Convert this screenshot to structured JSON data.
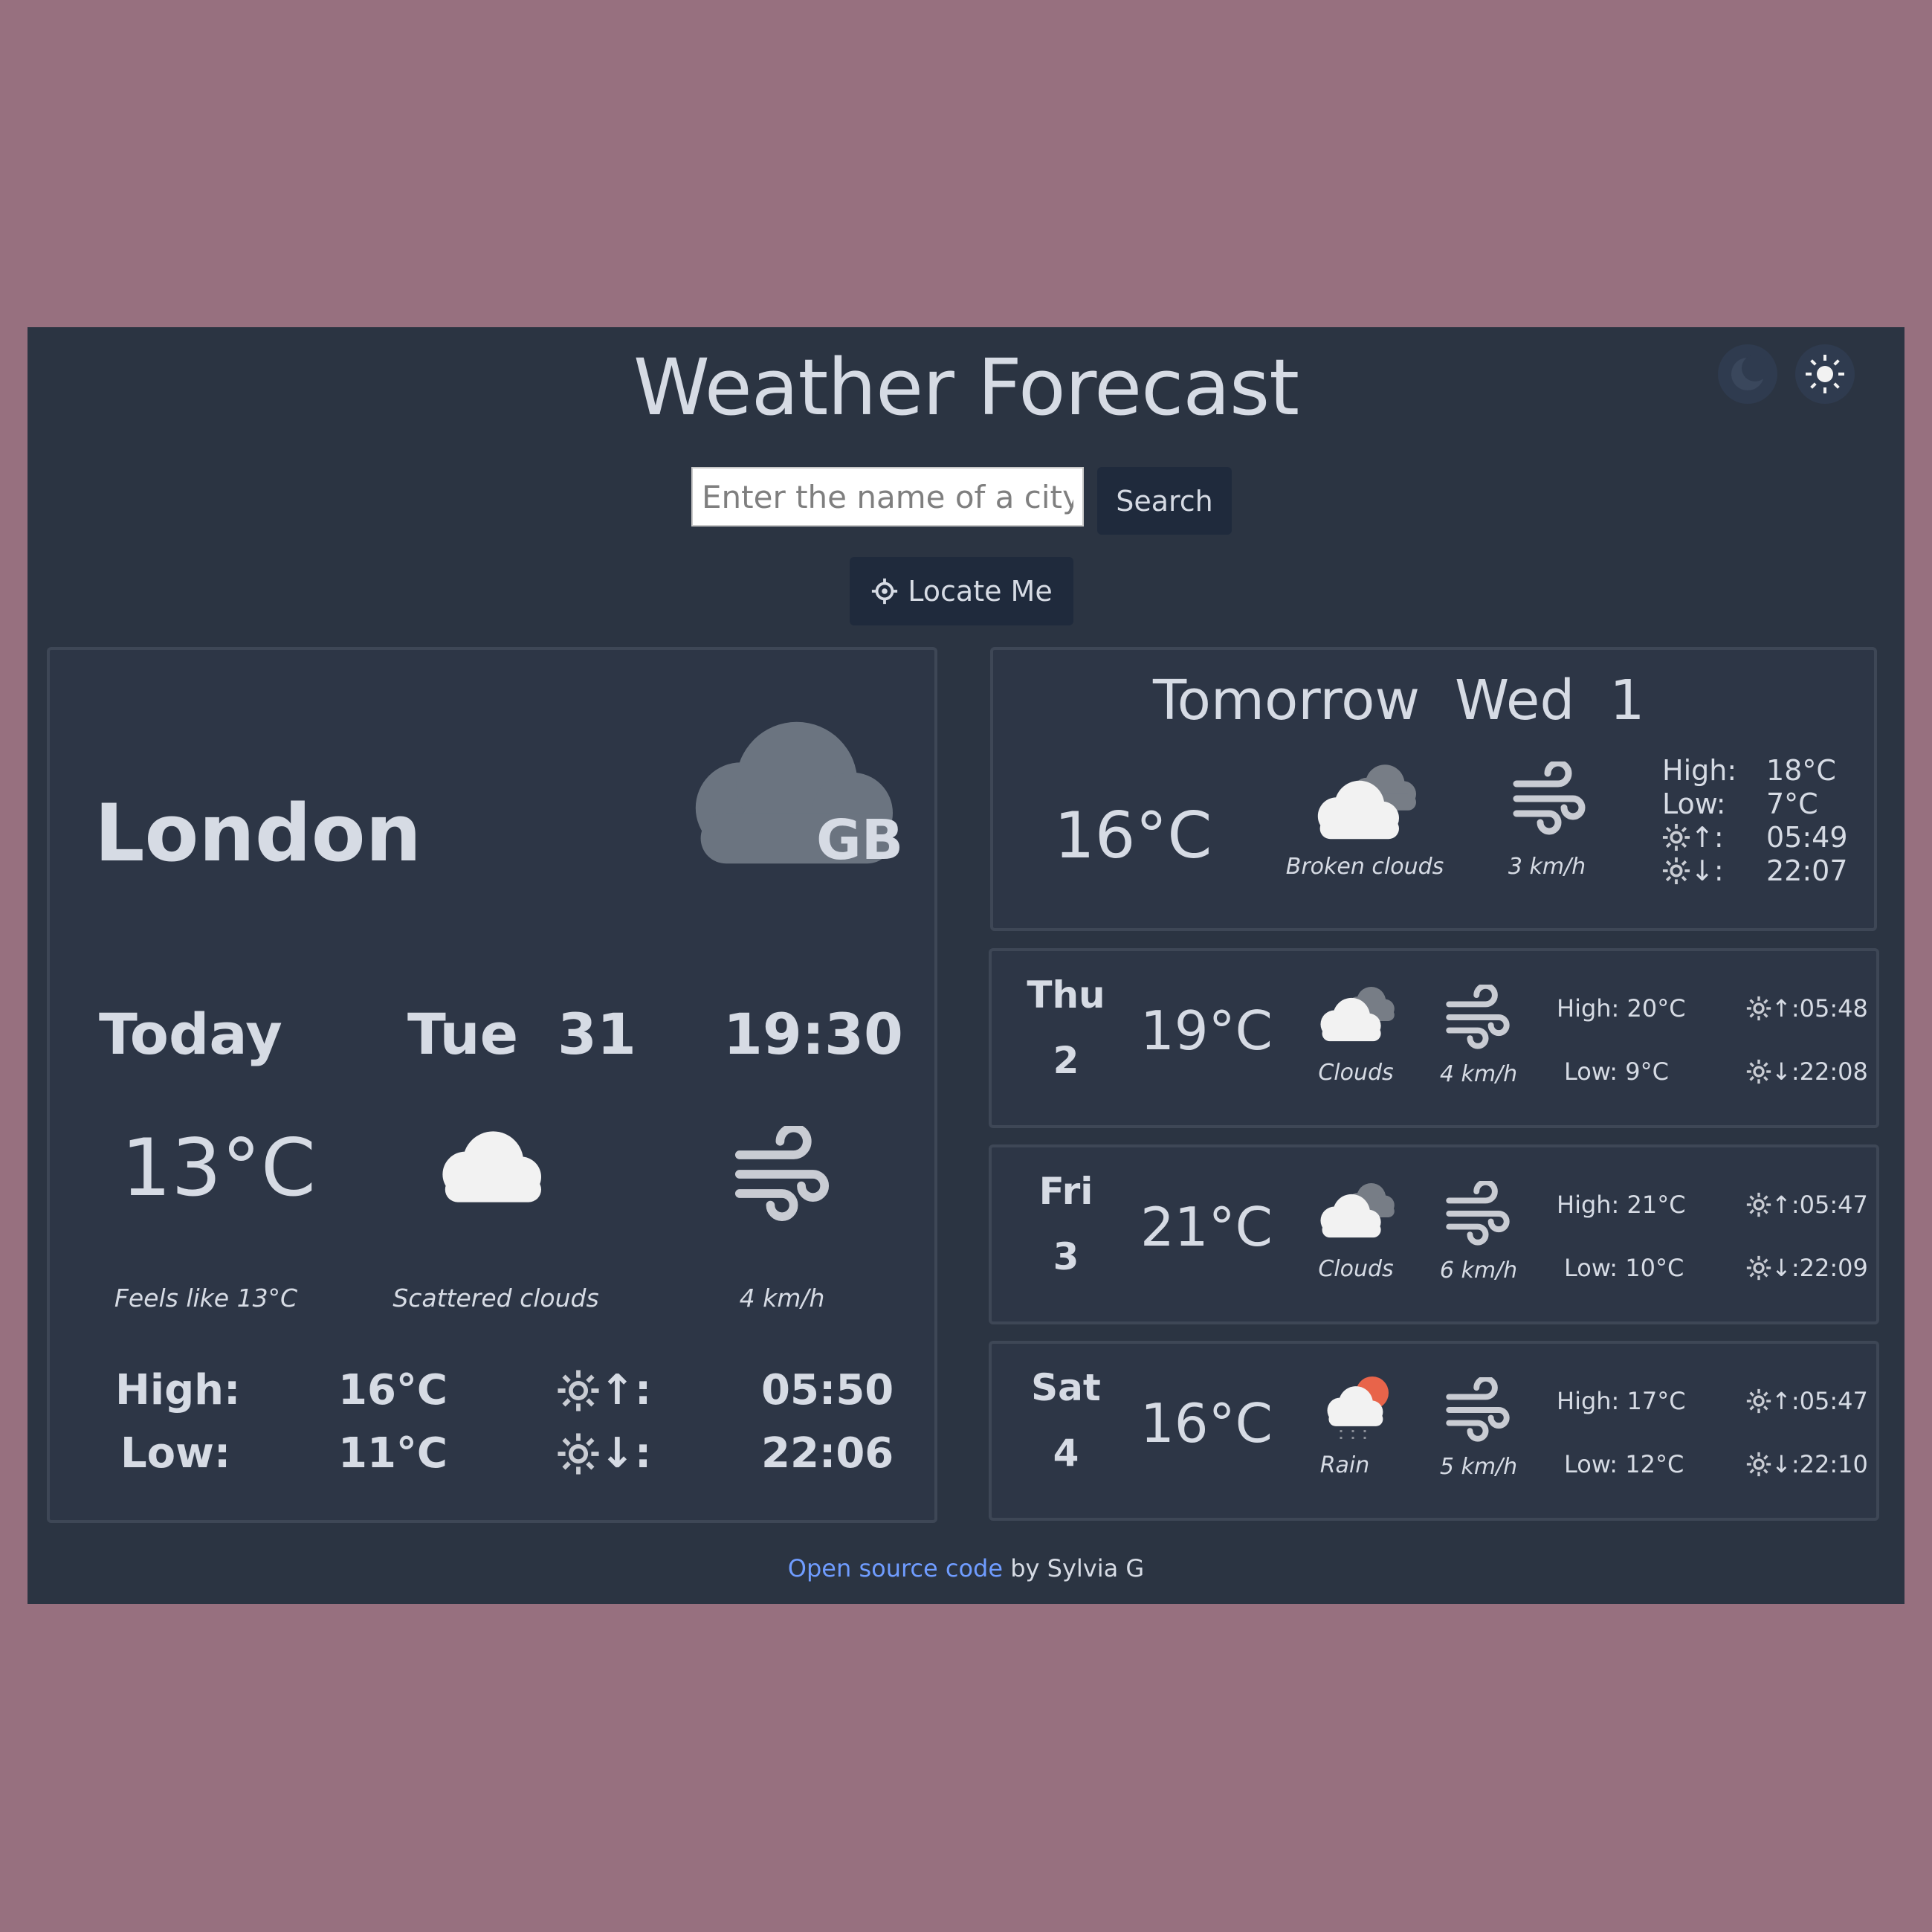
{
  "header": {
    "title": "Weather Forecast",
    "search_placeholder": "Enter the name of a city",
    "search_label": "Search",
    "locate_label": "Locate Me"
  },
  "today": {
    "city": "London",
    "country": "GB",
    "day_label": "Today",
    "date": "Tue  31",
    "time": "19:30",
    "temp": "13°C",
    "feels_like": "Feels like 13°C",
    "description": "Scattered clouds",
    "wind": "4 km/h",
    "high_label": "High:",
    "high": "16°C",
    "low_label": "Low:",
    "low": "11°C",
    "sunrise_label": ":",
    "sunrise": "05:50",
    "sunset_label": ":",
    "sunset": "22:06",
    "icon": "cloud-icon"
  },
  "tomorrow": {
    "title": "Tomorrow  Wed  1",
    "temp": "16°C",
    "description": "Broken clouds",
    "wind": "3 km/h",
    "high_label": "High:",
    "high": "18°C",
    "low_label": "Low:",
    "low": "7°C",
    "sunrise_label": ":",
    "sunrise": "05:49",
    "sunset_label": ":",
    "sunset": "22:07",
    "icon": "broken-clouds-icon"
  },
  "forecast": [
    {
      "day": "Thu",
      "date": "2",
      "temp": "19°C",
      "description": "Clouds",
      "wind": "4 km/h",
      "high": "High: 20°C",
      "low": "Low: 9°C",
      "sunrise": ":05:48",
      "sunset": ":22:08",
      "icon": "clouds-icon"
    },
    {
      "day": "Fri",
      "date": "3",
      "temp": "21°C",
      "description": "Clouds",
      "wind": "6 km/h",
      "high": "High: 21°C",
      "low": "Low: 10°C",
      "sunrise": ":05:47",
      "sunset": ":22:09",
      "icon": "clouds-icon"
    },
    {
      "day": "Sat",
      "date": "4",
      "temp": "16°C",
      "description": "Rain",
      "wind": "5 km/h",
      "high": "High: 17°C",
      "low": "Low: 12°C",
      "sunrise": ":05:47",
      "sunset": ":22:10",
      "icon": "rain-icon"
    }
  ],
  "footer": {
    "link": "Open source code",
    "text": " by Sylvia G"
  },
  "colors": {
    "background": "#97707f",
    "app": "#2b3442",
    "card": "#2d3646",
    "link": "#6f9cff",
    "sun": "#e8644a"
  }
}
